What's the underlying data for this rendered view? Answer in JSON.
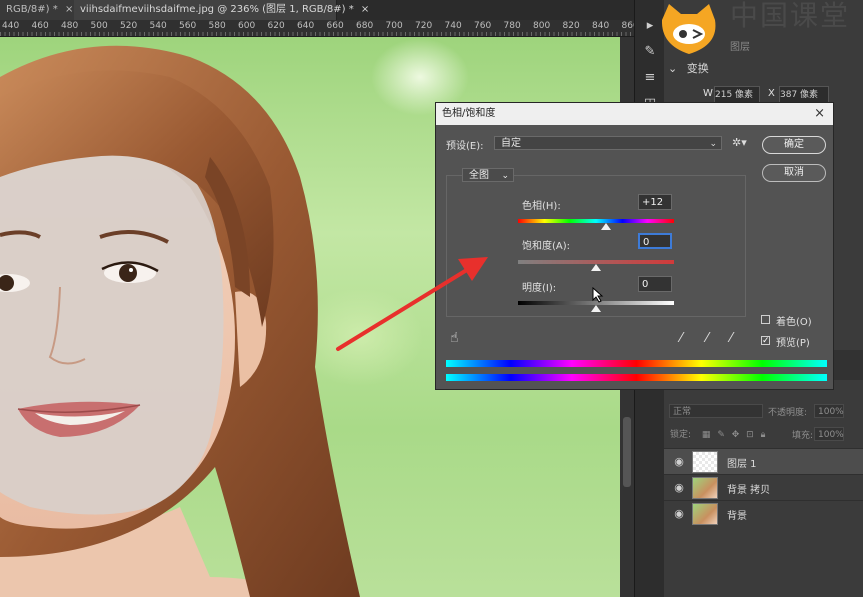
{
  "tabs": [
    {
      "label": "RGB/8#) *",
      "close": "×"
    },
    {
      "label": "viihsdaifmeviihsdaifme.jpg @ 236% (图层 1, RGB/8#) *",
      "close": "×"
    }
  ],
  "ruler": [
    "440",
    "460",
    "480",
    "500",
    "520",
    "540",
    "560",
    "580",
    "600",
    "620",
    "640",
    "660",
    "680",
    "700",
    "720",
    "740",
    "760",
    "780",
    "800",
    "820",
    "840",
    "860"
  ],
  "watermark": {
    "brand": "中国课堂"
  },
  "properties": {
    "title": "图层",
    "section": "变换",
    "w_label": "W",
    "w_value": "215 像素",
    "x_label": "X",
    "x_value": "387 像素"
  },
  "layers": {
    "blend_mode": "正常",
    "opacity_label": "不透明度:",
    "opacity_value": "100%",
    "lock_label": "锁定:",
    "fill_label": "填充:",
    "fill_value": "100%",
    "items": [
      {
        "name": "图层 1",
        "selected": true
      },
      {
        "name": "背景 拷贝",
        "selected": false
      },
      {
        "name": "背景",
        "selected": false
      }
    ]
  },
  "dialog": {
    "title": "色相/饱和度",
    "close": "×",
    "preset_label": "预设(E):",
    "preset_value": "自定",
    "ok": "确定",
    "cancel": "取消",
    "channel": "全图",
    "hue_label": "色相(H):",
    "hue_value": "+12",
    "saturation_label": "饱和度(A):",
    "saturation_value": "0",
    "lightness_label": "明度(I):",
    "lightness_value": "0",
    "colorize_label": "着色(O)",
    "colorize_checked": false,
    "preview_label": "预览(P)",
    "preview_checked": true
  },
  "colors": {
    "arrow": "#e8302c",
    "focus": "#3d7bd8"
  }
}
